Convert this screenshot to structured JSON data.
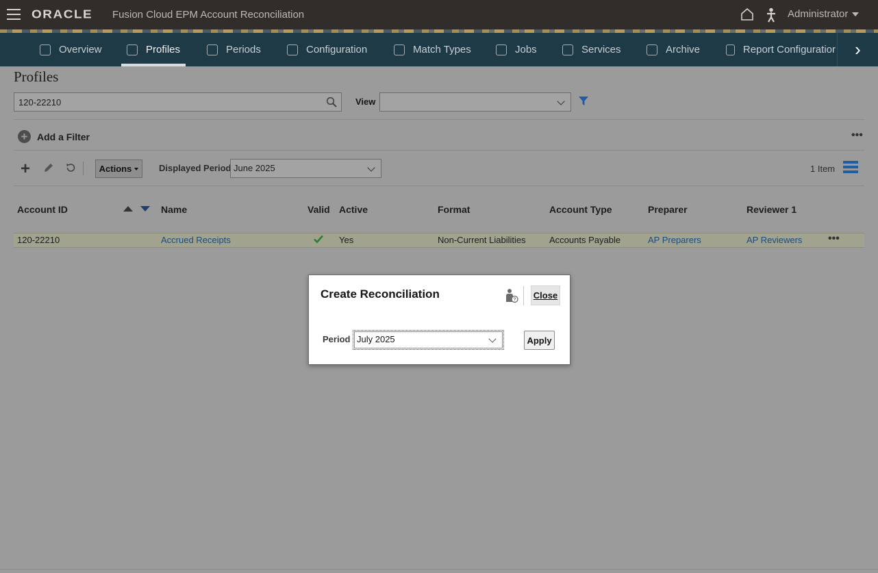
{
  "header": {
    "brand": "ORACLE",
    "app_title": "Fusion Cloud EPM Account Reconciliation",
    "user": "Administrator",
    "icons": [
      "hamburger-menu-icon",
      "home-icon",
      "accessibility-person-icon"
    ]
  },
  "nav": {
    "items": [
      {
        "label": "Overview",
        "icon": "cube-icon"
      },
      {
        "label": "Profiles",
        "icon": "clipboard-icon",
        "active": true
      },
      {
        "label": "Periods",
        "icon": "sliders-icon"
      },
      {
        "label": "Configuration",
        "icon": "tools-icon"
      },
      {
        "label": "Match Types",
        "icon": "match-doc-icon"
      },
      {
        "label": "Jobs",
        "icon": "clipboard-icon"
      },
      {
        "label": "Services",
        "icon": "briefcase-icon"
      },
      {
        "label": "Archive",
        "icon": "archive-pin-icon"
      },
      {
        "label": "Report Configuratior",
        "icon": "report-icon"
      }
    ]
  },
  "page": {
    "title": "Profiles",
    "search_value": "120-22210",
    "view_label": "View",
    "view_value": "",
    "add_filter_label": "Add a Filter",
    "actions_label": "Actions",
    "displayed_period_label": "Displayed Period",
    "displayed_period_value": "June 2025",
    "item_count": "1 Item"
  },
  "table": {
    "columns": [
      "Account ID",
      "Name",
      "Valid",
      "Active",
      "Format",
      "Account Type",
      "Preparer",
      "Reviewer 1"
    ],
    "rows": [
      {
        "account_id": "120-22210",
        "name": "Accrued Receipts",
        "valid": true,
        "active": "Yes",
        "format": "Non-Current Liabilities",
        "account_type": "Accounts Payable",
        "preparer": "AP Preparers",
        "reviewer1": "AP Reviewers"
      }
    ]
  },
  "dialog": {
    "title": "Create Reconciliation",
    "close_label": "Close",
    "period_label": "Period",
    "period_value": "July 2025",
    "apply_label": "Apply"
  },
  "colors": {
    "topbar": "#312d2a",
    "navbar": "#1e3a47",
    "accent_link": "#1b4b7f",
    "valid_check": "#2e7d32",
    "overlay": "#9b9b9b"
  }
}
